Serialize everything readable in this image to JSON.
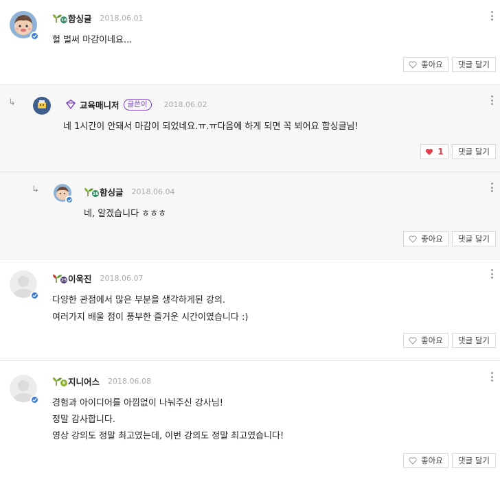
{
  "buttons": {
    "like_label": "좋아요",
    "reply_label": "댓글 달기"
  },
  "comments": [
    {
      "author": "함싱글",
      "level": "16",
      "date": "2018.06.01",
      "text": "헐 벌써 마감이네요..."
    },
    {
      "author": "교육매니저",
      "badge": "글쓴이",
      "date": "2018.06.02",
      "text": "네 1시간이 안돼서 마감이 되었네요.ㅠ.ㅠ다음에 하게 되면 꼭 뵈어요 함싱글님!",
      "likes": "1"
    },
    {
      "author": "함싱글",
      "level": "16",
      "date": "2018.06.04",
      "text": "네, 알겠습니다 ㅎㅎㅎ"
    },
    {
      "author": "이욱진",
      "level": "25",
      "date": "2018.06.07",
      "text1": "다양한 관점에서 많은 부분을 생각하게된 강의.",
      "text2": "여러가지 배울 점이 풍부한 즐거운 시간이였습니다 :)"
    },
    {
      "author": "지니어스",
      "level": "8",
      "date": "2018.06.08",
      "text1": "경험과 아이디어를 아낌없이 나눠주신 강사님!",
      "text2": "정말 감사합니다.",
      "text3": "영상 강의도 정말 최고였는데, 이번 강의도 정말 최고였습니다!"
    }
  ],
  "colors": {
    "verified": "#3a7bd5",
    "badge": "#7b3fc4",
    "like_heart": "#e03c4a"
  }
}
